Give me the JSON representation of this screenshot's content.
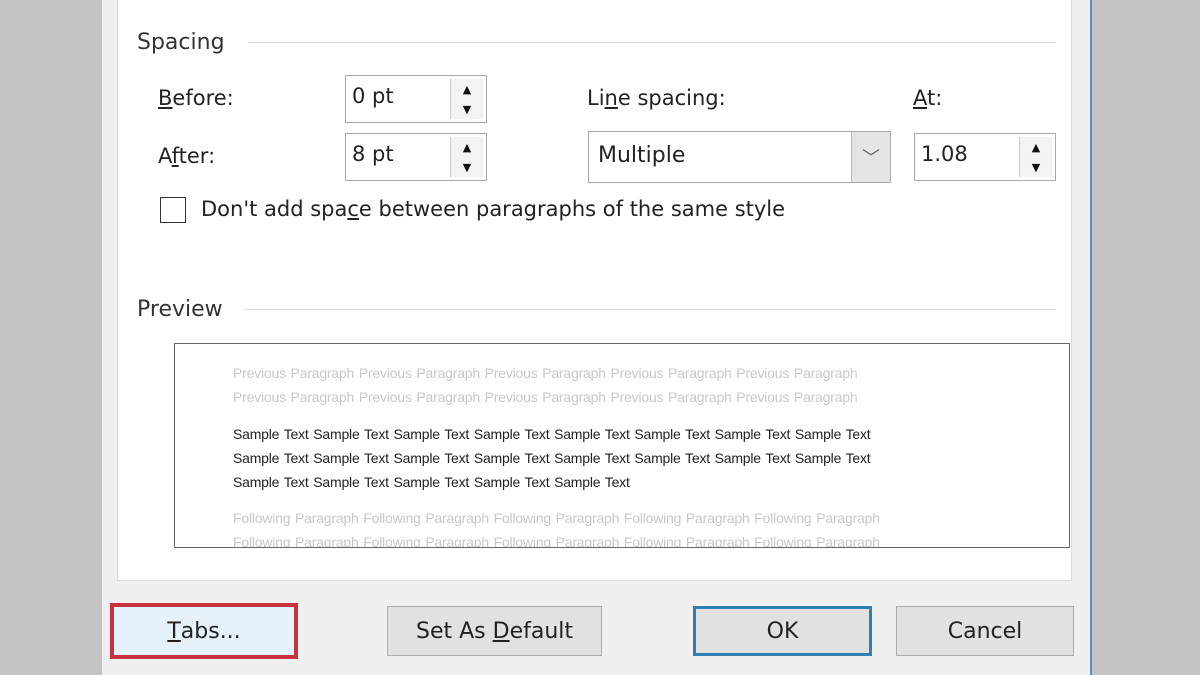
{
  "spacing": {
    "group_label": "Spacing",
    "before": {
      "label_accel": "B",
      "label_rest": "efore:",
      "value": "0 pt"
    },
    "after": {
      "label_pre": "A",
      "label_accel": "f",
      "label_rest": "ter:",
      "value": "8 pt"
    },
    "line_spacing": {
      "label_pre": "Li",
      "label_accel": "n",
      "label_rest": "e spacing:",
      "value": "Multiple"
    },
    "at": {
      "label_accel": "A",
      "label_rest": "t:",
      "value": "1.08"
    },
    "dont_add_space": {
      "label_pre": "Don't add spa",
      "label_accel": "c",
      "label_rest": "e between paragraphs of the same style",
      "checked": false
    }
  },
  "preview": {
    "group_label": "Preview",
    "previous_lines": [
      "Previous Paragraph Previous Paragraph Previous Paragraph Previous Paragraph Previous Paragraph",
      "Previous Paragraph Previous Paragraph Previous Paragraph Previous Paragraph Previous Paragraph"
    ],
    "sample_lines": [
      "Sample Text Sample Text Sample Text Sample Text Sample Text Sample Text Sample Text Sample Text",
      "Sample Text Sample Text Sample Text Sample Text Sample Text Sample Text Sample Text Sample Text",
      "Sample Text Sample Text Sample Text Sample Text Sample Text"
    ],
    "following_lines": [
      "Following Paragraph Following Paragraph Following Paragraph Following Paragraph Following Paragraph",
      "Following Paragraph Following Paragraph Following Paragraph Following Paragraph Following Paragraph"
    ]
  },
  "buttons": {
    "tabs": {
      "accel": "T",
      "rest": "abs..."
    },
    "set_default": {
      "pre": "Set As ",
      "accel": "D",
      "rest": "efault"
    },
    "ok": "OK",
    "cancel": "Cancel"
  },
  "colors": {
    "highlight": "#c8323c",
    "focus": "#2f7fb0",
    "window_border": "#5b8fc7"
  }
}
